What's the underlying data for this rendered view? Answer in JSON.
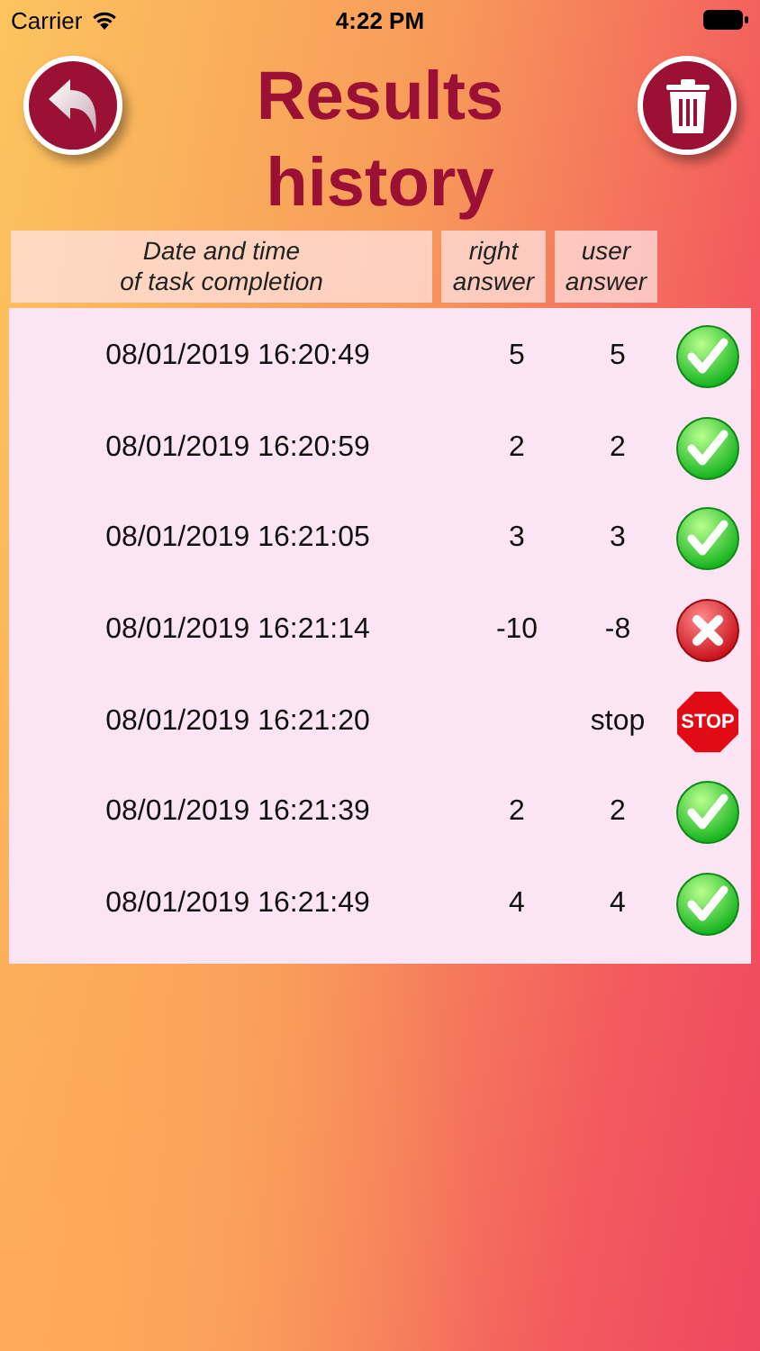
{
  "status_bar": {
    "carrier": "Carrier",
    "time": "4:22 PM"
  },
  "title": "Results history",
  "table": {
    "columns": [
      {
        "label": "Date and time\nof task completion"
      },
      {
        "label": "right\nanswer"
      },
      {
        "label": "user\nanswer"
      }
    ],
    "rows": [
      {
        "datetime": "08/01/2019 16:20:49",
        "right_answer": "5",
        "user_answer": "5",
        "result": {
          "kind": "correct"
        }
      },
      {
        "datetime": "08/01/2019 16:20:59",
        "right_answer": "2",
        "user_answer": "2",
        "result": {
          "kind": "correct"
        }
      },
      {
        "datetime": "08/01/2019 16:21:05",
        "right_answer": "3",
        "user_answer": "3",
        "result": {
          "kind": "correct"
        }
      },
      {
        "datetime": "08/01/2019 16:21:14",
        "right_answer": "-10",
        "user_answer": "-8",
        "result": {
          "kind": "wrong"
        }
      },
      {
        "datetime": "08/01/2019 16:21:20",
        "user_answer": "stop",
        "result": {
          "kind": "stop",
          "sign_text": "STOP"
        }
      },
      {
        "datetime": "08/01/2019 16:21:39",
        "right_answer": "2",
        "user_answer": "2",
        "result": {
          "kind": "correct"
        }
      },
      {
        "datetime": "08/01/2019 16:21:49",
        "right_answer": "4",
        "user_answer": "4",
        "result": {
          "kind": "correct"
        }
      }
    ]
  }
}
